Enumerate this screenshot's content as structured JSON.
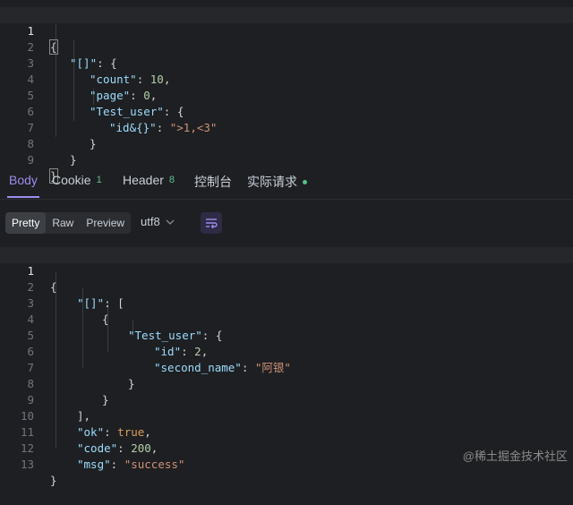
{
  "request_editor": {
    "lines": [
      {
        "num": "1"
      },
      {
        "num": "2"
      },
      {
        "num": "3"
      },
      {
        "num": "4"
      },
      {
        "num": "5"
      },
      {
        "num": "6"
      },
      {
        "num": "7"
      },
      {
        "num": "8"
      },
      {
        "num": "9"
      }
    ],
    "tokens": {
      "l2_key": "\"[]\"",
      "l3_key": "\"count\"",
      "l3_val": "10",
      "l4_key": "\"page\"",
      "l4_val": "0",
      "l5_key": "\"Test_user\"",
      "l6_key": "\"id&{}\"",
      "l6_val": "\">1,<3\""
    }
  },
  "tabs": {
    "body": "Body",
    "cookie": "Cookie",
    "cookie_count": "1",
    "header": "Header",
    "header_count": "8",
    "console": "控制台",
    "actual_request": "实际请求"
  },
  "toolbar": {
    "pretty": "Pretty",
    "raw": "Raw",
    "preview": "Preview",
    "encoding": "utf8",
    "wrap_icon": "wrap-lines-icon"
  },
  "response_editor": {
    "lines": [
      {
        "num": "1"
      },
      {
        "num": "2"
      },
      {
        "num": "3"
      },
      {
        "num": "4"
      },
      {
        "num": "5"
      },
      {
        "num": "6"
      },
      {
        "num": "7"
      },
      {
        "num": "8"
      },
      {
        "num": "9"
      },
      {
        "num": "10"
      },
      {
        "num": "11"
      },
      {
        "num": "12"
      },
      {
        "num": "13"
      }
    ],
    "tokens": {
      "l2_key": "\"[]\"",
      "l4_key": "\"Test_user\"",
      "l5_key": "\"id\"",
      "l5_val": "2",
      "l6_key": "\"second_name\"",
      "l6_val": "\"阿银\"",
      "l10_key": "\"ok\"",
      "l10_val": "true",
      "l11_key": "\"code\"",
      "l11_val": "200",
      "l12_key": "\"msg\"",
      "l12_val": "\"success\""
    }
  },
  "watermark": "@稀土掘金技术社区",
  "colors": {
    "accent": "#9d8cf0",
    "key": "#9cdcfe",
    "string": "#ce9178",
    "number": "#b5cea8",
    "status_dot": "#4fc38a"
  }
}
